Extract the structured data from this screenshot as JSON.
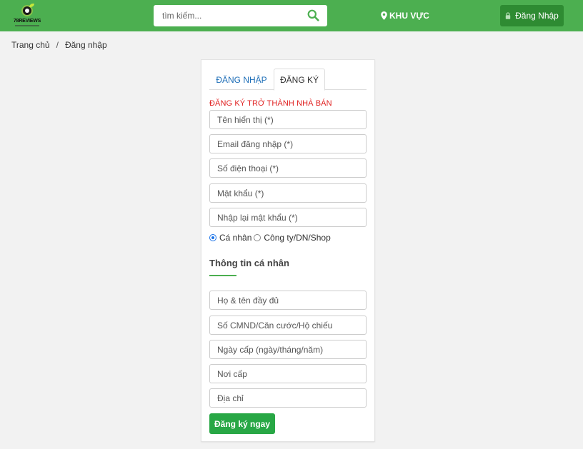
{
  "header": {
    "logo_text": "78REVIEWS",
    "search_placeholder": "tìm kiếm...",
    "search_icon": "search-icon",
    "region_label": "KHU VỰC",
    "region_icon": "map-marker-icon",
    "login_label": "Đăng Nhập",
    "login_icon": "lock-icon",
    "brand_color": "#4caf50"
  },
  "breadcrumb": {
    "home": "Trang chủ",
    "separator": "/",
    "current": "Đăng nhập"
  },
  "form": {
    "tabs": [
      {
        "label": "ĐĂNG NHẬP",
        "active": false
      },
      {
        "label": "ĐĂNG KÝ",
        "active": true
      }
    ],
    "section_title": "ĐĂNG KÝ TRỞ THÀNH NHÀ BÁN",
    "account_fields": {
      "display_name": "Tên hiển thị (*)",
      "email": "Email đăng nhập (*)",
      "phone": "Số điện thoại (*)",
      "password": "Mật khẩu (*)",
      "password_confirm": "Nhập lại mật khẩu (*)"
    },
    "account_type": {
      "options": [
        "Cá nhân",
        "Công ty/DN/Shop"
      ],
      "selected": "Cá nhân"
    },
    "personal_heading": "Thông tin cá nhân",
    "personal_fields": {
      "full_name": "Họ & tên đầy đủ",
      "id_number": "Số CMND/Căn cước/Hộ chiếu",
      "issue_date": "Ngày cấp (ngày/tháng/năm)",
      "issue_place": "Nơi cấp",
      "address": "Địa chỉ"
    },
    "submit_label": "Đăng ký ngay"
  }
}
